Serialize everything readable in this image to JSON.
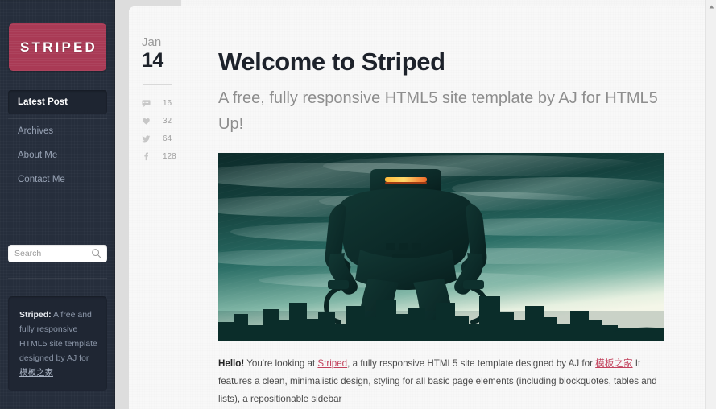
{
  "sidebar": {
    "logo": "STRIPED",
    "nav": [
      {
        "label": "Latest Post",
        "active": true
      },
      {
        "label": "Archives",
        "active": false
      },
      {
        "label": "About Me",
        "active": false
      },
      {
        "label": "Contact Me",
        "active": false
      }
    ],
    "search": {
      "placeholder": "Search",
      "value": "",
      "icon": "search-icon"
    },
    "infobox": {
      "lead": "Striped:",
      "text": " A free and fully responsive HTML5 site template designed by AJ for ",
      "link": "模板之家"
    },
    "colors": {
      "background": "#262e3c",
      "logo_background": "#a93a55",
      "active_item": "#1e2531"
    }
  },
  "meta": {
    "month": "Jan",
    "day": "14",
    "stats": [
      {
        "icon": "comment-icon",
        "value": "16"
      },
      {
        "icon": "heart-icon",
        "value": "32"
      },
      {
        "icon": "twitter-icon",
        "value": "64"
      },
      {
        "icon": "facebook-icon",
        "value": "128"
      }
    ]
  },
  "post": {
    "title": "Welcome to Striped",
    "subtitle": "A free, fully responsive HTML5 site template by AJ for HTML5 Up!",
    "hero_alt": "robot-city-illustration",
    "body": {
      "lead": "Hello!",
      "part1": " You're looking at ",
      "link1": "Striped",
      "part2": ", a fully responsive HTML5 site template designed by AJ for ",
      "link2": "模板之家",
      "part3": " It features a clean, minimalistic design, styling for all basic page elements (including blockquotes, tables and lists), a repositionable sidebar"
    },
    "accent_link_color": "#c2415c"
  },
  "scrollbar": {
    "up_arrow": "scroll-up-icon"
  }
}
